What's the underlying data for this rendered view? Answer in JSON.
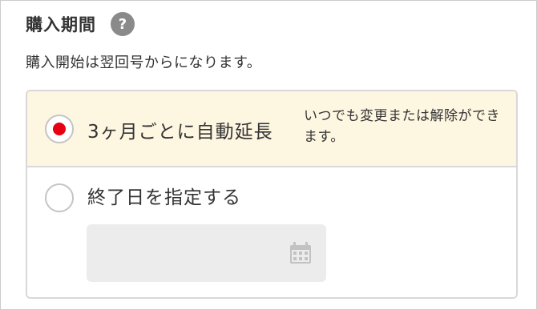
{
  "section": {
    "title": "購入期間",
    "help_icon": "?"
  },
  "note": "購入開始は翌回号からになります。",
  "options": {
    "auto_renew": {
      "label": "3ヶ月ごとに自動延長",
      "description": "いつでも変更または解除ができます。",
      "selected": true
    },
    "end_date": {
      "label": "終了日を指定する",
      "selected": false,
      "date_value": ""
    }
  },
  "icons": {
    "help": "question-circle-icon",
    "calendar": "calendar-icon"
  },
  "colors": {
    "selected_background": "#fdf6e1",
    "radio_selected": "#e60012",
    "help_icon": "#8a8a8a",
    "date_field": "#ececec"
  }
}
